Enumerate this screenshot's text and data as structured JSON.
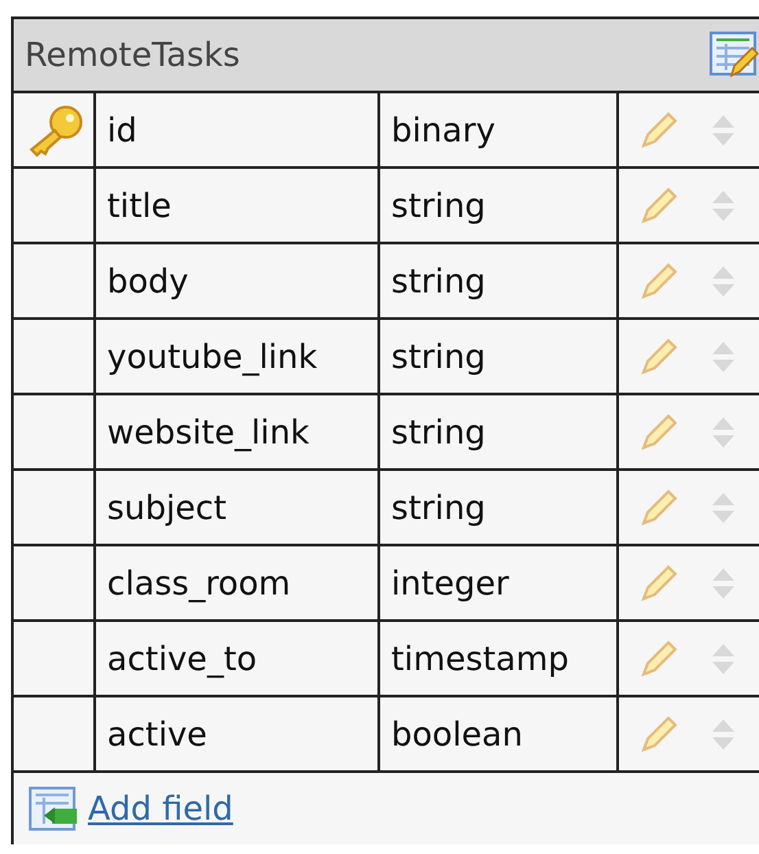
{
  "table": {
    "title": "RemoteTasks",
    "fields": [
      {
        "name": "id",
        "type": "binary",
        "primary_key": true
      },
      {
        "name": "title",
        "type": "string",
        "primary_key": false
      },
      {
        "name": "body",
        "type": "string",
        "primary_key": false
      },
      {
        "name": "youtube_link",
        "type": "string",
        "primary_key": false
      },
      {
        "name": "website_link",
        "type": "string",
        "primary_key": false
      },
      {
        "name": "subject",
        "type": "string",
        "primary_key": false
      },
      {
        "name": "class_room",
        "type": "integer",
        "primary_key": false
      },
      {
        "name": "active_to",
        "type": "timestamp",
        "primary_key": false
      },
      {
        "name": "active",
        "type": "boolean",
        "primary_key": false
      }
    ],
    "add_link": "Add field"
  }
}
